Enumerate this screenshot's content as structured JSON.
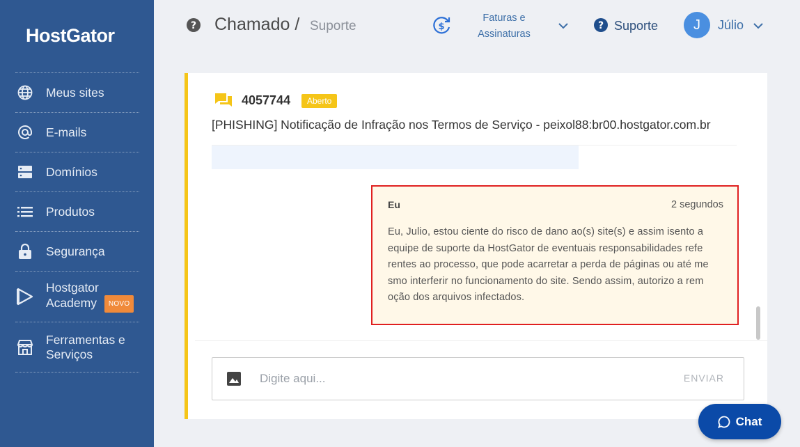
{
  "sidebar": {
    "logo": "HostGator",
    "items": [
      {
        "label": "Meus sites",
        "icon": "globe-icon"
      },
      {
        "label": "E-mails",
        "icon": "at-icon"
      },
      {
        "label": "Domínios",
        "icon": "server-icon"
      },
      {
        "label": "Produtos",
        "icon": "list-icon"
      },
      {
        "label": "Segurança",
        "icon": "lock-icon"
      },
      {
        "label": "Hostgator",
        "label2": "Academy",
        "badge": "NOVO",
        "icon": "play-icon"
      },
      {
        "label": "Ferramentas e",
        "label2": "Serviços",
        "icon": "store-icon"
      }
    ]
  },
  "header": {
    "title": "Chamado /",
    "subtitle": "Suporte",
    "billing_line1": "Faturas e",
    "billing_line2": "Assinaturas",
    "support": "Suporte",
    "avatar_initial": "J",
    "user": "Júlio"
  },
  "ticket": {
    "number": "4057744",
    "status": "Aberto",
    "title": "[PHISHING] Notificação de Infração nos Termos de Serviço - peixol88:br00.hostgator.com.br"
  },
  "message": {
    "author": "Eu",
    "time": "2 segundos",
    "lines": [
      "Eu, Julio, estou ciente do risco de dano ao(s) site(s) e assim isento a",
      "equipe de suporte da HostGator de eventuais responsabilidades refe",
      "rentes ao processo, que pode acarretar a perda de páginas ou até me",
      "smo interferir no funcionamento do site. Sendo assim, autorizo a rem",
      "oção dos arquivos infectados."
    ]
  },
  "composer": {
    "placeholder": "Digite aqui...",
    "send": "ENVIAR"
  },
  "chat": {
    "label": "Chat"
  },
  "colors": {
    "sidebar": "#2f5891",
    "accent_yellow": "#f5c518",
    "highlight_red": "#e02020",
    "chat_button": "#0b4aa8"
  }
}
